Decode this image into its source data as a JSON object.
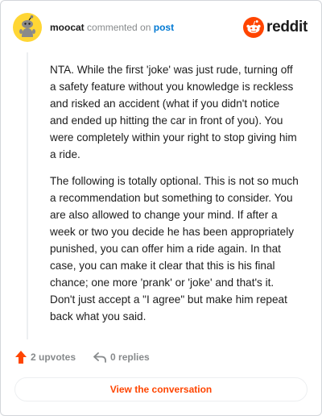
{
  "comment": {
    "author": "moocat",
    "action_text": "commented on",
    "post_link": "post",
    "paragraphs": [
      "NTA. While the first 'joke' was just rude, turning off a safety feature without you knowledge is reckless and risked an accident (what if you didn't notice and ended up hitting the car in front of you). You were completely within your right to stop giving him a ride.",
      "The following is totally optional. This is not so much a recommendation but something to consider. You are also allowed to change your mind. If after a week or two you decide he has been appropriately punished, you can offer him a ride again. In that case, you can make it clear that this is his final chance; one more 'prank' or 'joke' and that's it. Don't just accept a \"I agree\" but make him repeat back what you said."
    ]
  },
  "brand": {
    "name": "reddit",
    "color": "#ff4500"
  },
  "actions": {
    "upvotes_label": "2 upvotes",
    "replies_label": "0 replies"
  },
  "cta": {
    "label": "View the conversation"
  },
  "icons": {
    "avatar": "snoo-avatar-icon",
    "brand": "reddit-logo-icon",
    "upvote": "upvote-arrow-icon",
    "reply": "reply-arrow-icon"
  }
}
